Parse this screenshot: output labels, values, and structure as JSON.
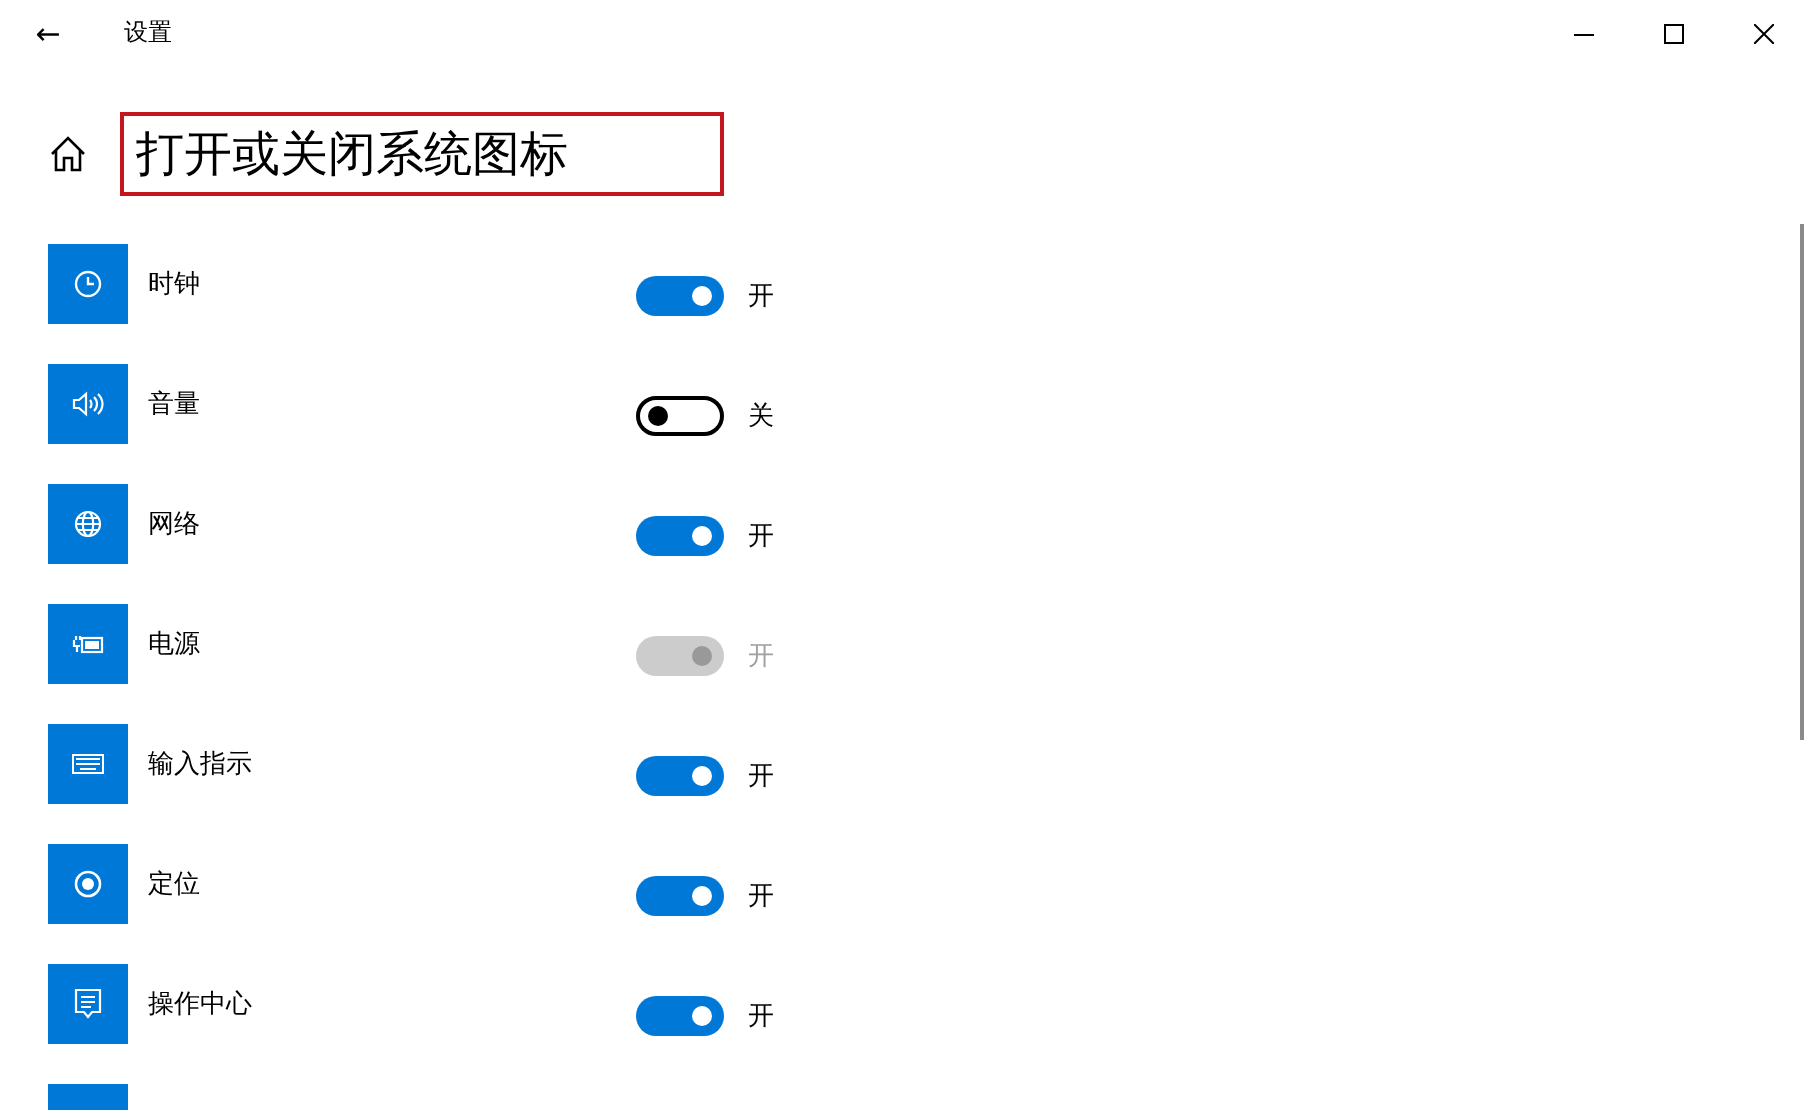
{
  "window": {
    "title": "设置",
    "back": "←"
  },
  "page": {
    "title": "打开或关闭系统图标",
    "highlighted": true
  },
  "items": [
    {
      "label": "时钟",
      "on": true,
      "disabled": false,
      "state_label": "开"
    },
    {
      "label": "音量",
      "on": false,
      "disabled": false,
      "state_label": "关"
    },
    {
      "label": "网络",
      "on": true,
      "disabled": false,
      "state_label": "开"
    },
    {
      "label": "电源",
      "on": true,
      "disabled": true,
      "state_label": "开"
    },
    {
      "label": "输入指示",
      "on": true,
      "disabled": false,
      "state_label": "开"
    },
    {
      "label": "定位",
      "on": true,
      "disabled": false,
      "state_label": "开"
    },
    {
      "label": "操作中心",
      "on": true,
      "disabled": false,
      "state_label": "开"
    }
  ]
}
